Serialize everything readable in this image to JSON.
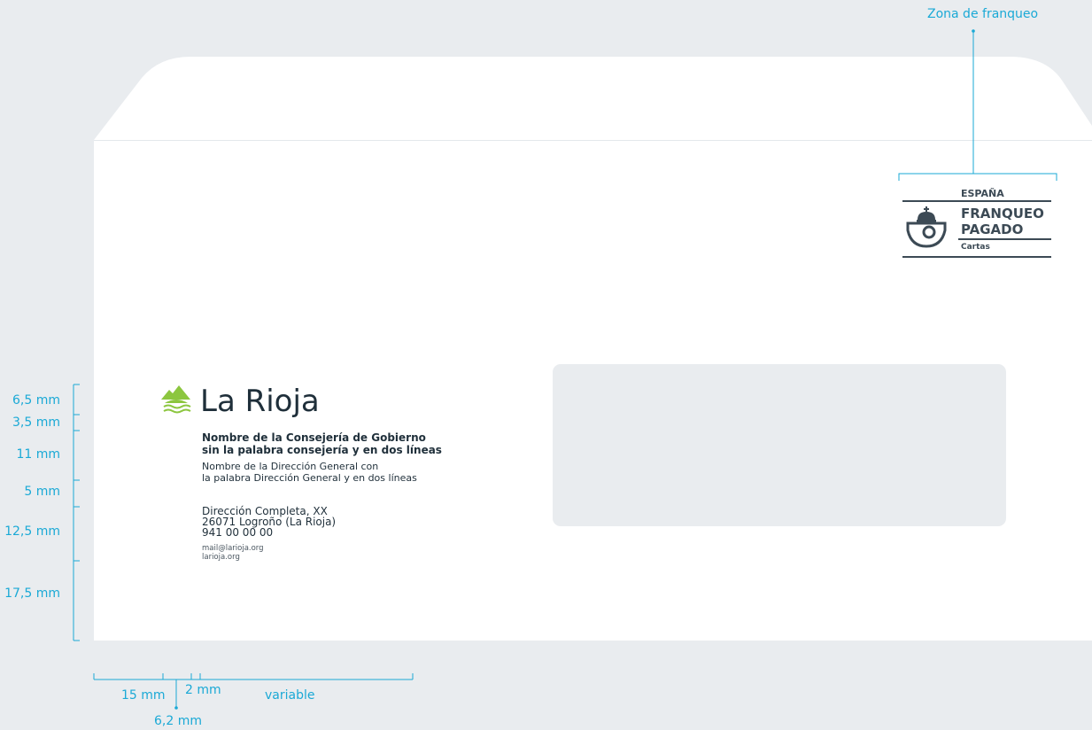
{
  "postage_zone_label": "Zona de franqueo",
  "postage": {
    "country": "ESPAÑA",
    "line1": "FRANQUEO",
    "line2": "PAGADO",
    "category": "Cartas"
  },
  "brand": {
    "name": "La Rioja",
    "logo_icon": "mountains-river-icon"
  },
  "sender": {
    "consejeria_line1": "Nombre de la Consejería de Gobierno",
    "consejeria_line2": "sin la palabra consejería y en dos líneas",
    "direccion_line1": "Nombre de la Dirección General con",
    "direccion_line2": "la palabra Dirección General y en dos líneas",
    "address_line1": "Dirección Completa, XX",
    "address_line2": "26071 Logroño (La Rioja)",
    "phone": "941 00 00 00",
    "email": "mail@larioja.org",
    "web": "larioja.org"
  },
  "vertical_dimensions": [
    "6,5 mm",
    "3,5 mm",
    "11 mm",
    "5 mm",
    "12,5 mm",
    "17,5 mm"
  ],
  "horizontal_dimensions": {
    "left_margin": "15 mm",
    "logo_offset": "6,2 mm",
    "gap": "2 mm",
    "text_width": "variable"
  },
  "colors": {
    "background": "#e9ecef",
    "envelope": "#ffffff",
    "dimension_lines": "#1aa9d6",
    "logo_green": "#8cc63f",
    "text_dark": "#1f2f3a",
    "postage_gray": "#3c4a55"
  }
}
